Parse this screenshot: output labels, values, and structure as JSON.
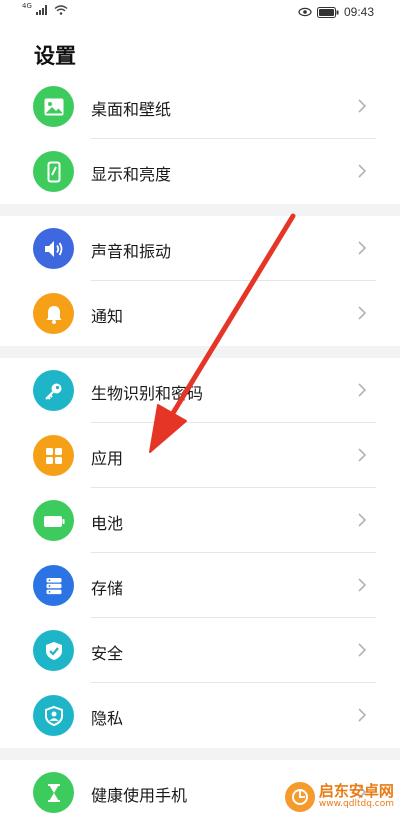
{
  "status_bar": {
    "network_type": "4G",
    "time": "09:43"
  },
  "page": {
    "title": "设置"
  },
  "groups": [
    {
      "items": [
        {
          "label": "桌面和壁纸",
          "icon": "wallpaper-icon",
          "color": "#3ecb5e"
        },
        {
          "label": "显示和亮度",
          "icon": "display-phone-icon",
          "color": "#3ecb5e"
        }
      ]
    },
    {
      "items": [
        {
          "label": "声音和振动",
          "icon": "speaker-icon",
          "color": "#3d68e0"
        },
        {
          "label": "通知",
          "icon": "bell-icon",
          "color": "#f6a017"
        }
      ]
    },
    {
      "items": [
        {
          "label": "生物识别和密码",
          "icon": "key-icon",
          "color": "#1fb5c9"
        },
        {
          "label": "应用",
          "icon": "apps-grid-icon",
          "color": "#f6a017"
        },
        {
          "label": "电池",
          "icon": "battery-icon",
          "color": "#3ecb5e"
        },
        {
          "label": "存储",
          "icon": "storage-icon",
          "color": "#2c74e4"
        },
        {
          "label": "安全",
          "icon": "shield-check-icon",
          "color": "#1fb5c9"
        },
        {
          "label": "隐私",
          "icon": "privacy-shield-icon",
          "color": "#1fb5c9"
        }
      ]
    },
    {
      "items": [
        {
          "label": "健康使用手机",
          "icon": "hourglass-icon",
          "color": "#3ecb5e"
        }
      ]
    }
  ],
  "annotation": {
    "arrow_color": "#e53527"
  },
  "watermark": {
    "title": "启东安卓网",
    "url": "www.qdltdq.com",
    "color": "#ea7b14"
  }
}
